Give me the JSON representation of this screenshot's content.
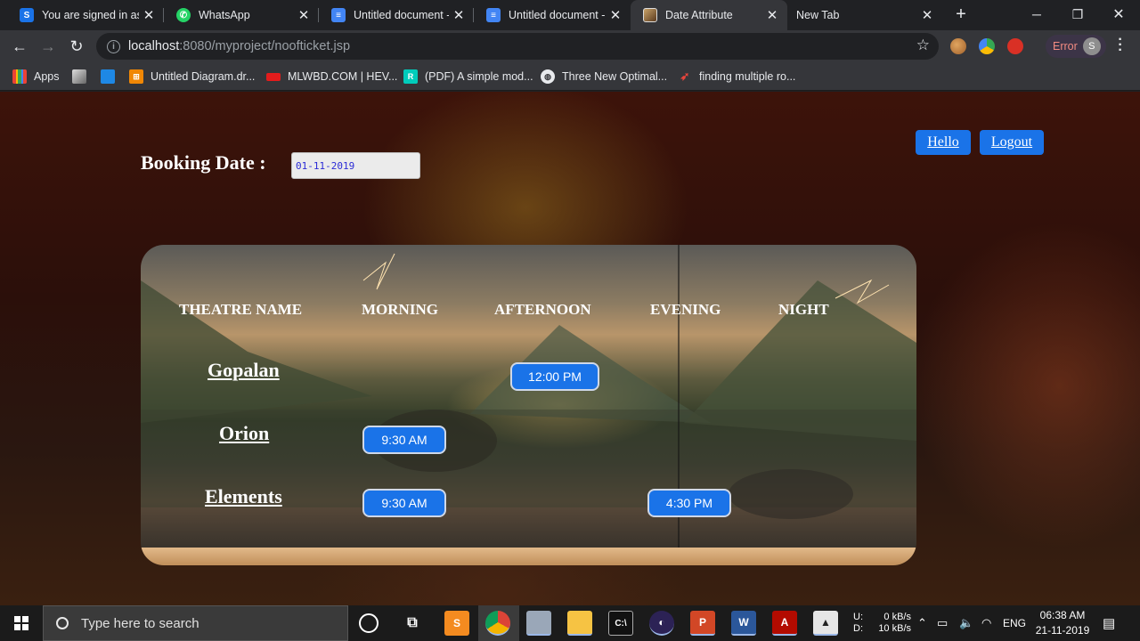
{
  "browser": {
    "tabs": [
      {
        "title": "You are signed in as",
        "icon": "s-app-icon",
        "color": "#1a73e8",
        "active": false
      },
      {
        "title": "WhatsApp",
        "icon": "whatsapp-icon",
        "color": "#25d366",
        "active": false
      },
      {
        "title": "Untitled document -",
        "icon": "docs-icon",
        "color": "#4285f4",
        "active": false
      },
      {
        "title": "Untitled document -",
        "icon": "docs-icon",
        "color": "#4285f4",
        "active": false
      },
      {
        "title": "Date Attribute",
        "icon": "page-image-icon",
        "color": "#8a6d3b",
        "active": true
      },
      {
        "title": "New Tab",
        "icon": "",
        "color": "",
        "active": false
      }
    ],
    "url_host": "localhost",
    "url_path": ":8080/myproject/noofticket.jsp",
    "profile_status": "Error",
    "profile_initial": "S",
    "bookmarks": [
      {
        "label": "Apps",
        "icon": "apps-grid-icon"
      },
      {
        "label": "",
        "icon": "image-bookmark-icon"
      },
      {
        "label": "",
        "icon": "blue-square-icon"
      },
      {
        "label": "Untitled Diagram.dr...",
        "icon": "drawio-icon"
      },
      {
        "label": "MLWBD.COM | HEV...",
        "icon": "mlwbd-icon"
      },
      {
        "label": "(PDF) A simple mod...",
        "icon": "researchgate-icon"
      },
      {
        "label": "Three New Optimal...",
        "icon": "globe-icon"
      },
      {
        "label": "finding multiple ro...",
        "icon": "bird-icon"
      }
    ]
  },
  "page": {
    "booking_label": "Booking Date :",
    "booking_date": "01-11-2019",
    "hello_button": "Hello",
    "logout_button": "Logout",
    "columns": [
      "THEATRE NAME",
      "MORNING",
      "AFTERNOON",
      "EVENING",
      "NIGHT"
    ],
    "theatres": [
      {
        "name": "Gopalan",
        "morning": "",
        "afternoon": "12:00 PM",
        "evening": "",
        "night": ""
      },
      {
        "name": "Orion",
        "morning": "9:30 AM",
        "afternoon": "",
        "evening": "",
        "night": ""
      },
      {
        "name": "Elements",
        "morning": "9:30 AM",
        "afternoon": "",
        "evening": "4:30 PM",
        "night": ""
      }
    ]
  },
  "taskbar": {
    "search_placeholder": "Type here to search",
    "net_up_label": "U:",
    "net_down_label": "D:",
    "net_up": "0 kB/s",
    "net_down": "10 kB/s",
    "language": "ENG",
    "time": "06:38 AM",
    "date": "21-11-2019"
  }
}
